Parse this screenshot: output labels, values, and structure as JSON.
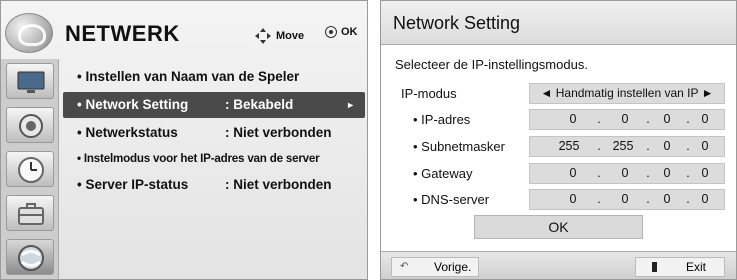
{
  "left_menu": {
    "title": "NETWERK",
    "move_hint": "Move",
    "ok_hint": "OK",
    "category_icons": [
      "tv-icon",
      "speaker-icon",
      "clock-icon",
      "toolbox-icon",
      "network-globe-icon"
    ],
    "items": [
      {
        "label": "• Instellen van Naam van de Speler",
        "value": "",
        "selected": false
      },
      {
        "label": "• Network Setting",
        "value": ": Bekabeld",
        "selected": true,
        "arrow": "►"
      },
      {
        "label": "• Netwerkstatus",
        "value": ": Niet verbonden",
        "selected": false
      },
      {
        "label": "• Instelmodus voor het IP-adres van de server",
        "value": "",
        "selected": false
      },
      {
        "label": "• Server IP-status",
        "value": ": Niet verbonden",
        "selected": false
      }
    ]
  },
  "dialog": {
    "title": "Network Setting",
    "instruction": "Selecteer de IP-instellingsmodus.",
    "ip_mode": {
      "label": "IP-modus",
      "value": "◄ Handmatig instellen van IP ►"
    },
    "fields": [
      {
        "label": "• IP-adres",
        "octets": [
          "0",
          "0",
          "0",
          "0"
        ]
      },
      {
        "label": "• Subnetmasker",
        "octets": [
          "255",
          "255",
          "0",
          "0"
        ]
      },
      {
        "label": "• Gateway",
        "octets": [
          "0",
          "0",
          "0",
          "0"
        ]
      },
      {
        "label": "• DNS-server",
        "octets": [
          "0",
          "0",
          "0",
          "0"
        ]
      }
    ],
    "ok_label": "OK",
    "back_label": "Vorige.",
    "exit_label": "Exit"
  }
}
